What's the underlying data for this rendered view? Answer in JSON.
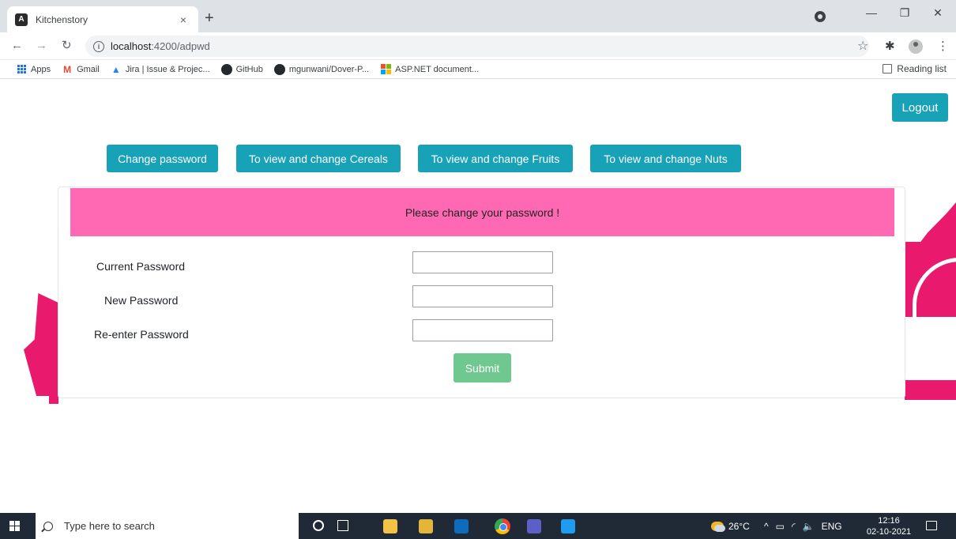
{
  "browser": {
    "tab_title": "Kitchenstory",
    "tab_close": "×",
    "new_tab": "+",
    "url_host": "localhost",
    "url_path": ":4200/adpwd",
    "bookmarks": [
      {
        "label": "Apps",
        "icon": "apps-grid-icon"
      },
      {
        "label": "Gmail",
        "icon": "gmail-icon"
      },
      {
        "label": "Jira | Issue & Projec...",
        "icon": "jira-icon"
      },
      {
        "label": "GitHub",
        "icon": "github-icon"
      },
      {
        "label": "mgunwani/Dover-P...",
        "icon": "github-icon"
      },
      {
        "label": "ASP.NET document...",
        "icon": "microsoft-icon"
      }
    ],
    "reading_list": "Reading list"
  },
  "page": {
    "logout_label": "Logout",
    "nav_buttons": [
      "Change password",
      "To view and change Cereals",
      "To view and change Fruits",
      "To view and change Nuts"
    ],
    "card_header": "Please change your password !",
    "form": {
      "current_password_label": "Current Password",
      "new_password_label": "New Password",
      "reenter_password_label": "Re-enter Password",
      "current_password_value": "",
      "new_password_value": "",
      "reenter_password_value": "",
      "submit_label": "Submit"
    },
    "colors": {
      "teal_button": "#17a2b8",
      "card_header_bg": "#ff69b4",
      "submit_bg": "#6fc890",
      "decoration_pink": "#e9196d"
    }
  },
  "taskbar": {
    "search_placeholder": "Type here to search",
    "temperature": "26°C",
    "language": "ENG",
    "time": "12:16",
    "date": "02-10-2021"
  }
}
